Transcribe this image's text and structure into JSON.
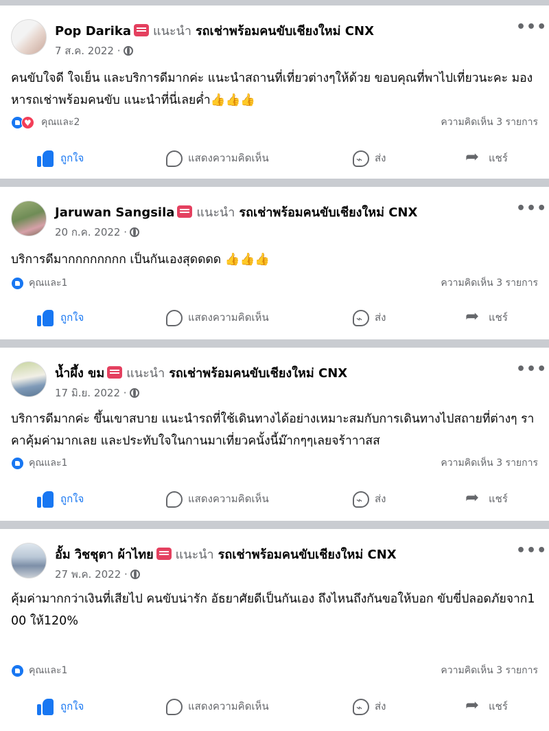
{
  "common": {
    "recommends": "แนะนำ",
    "page_name": "รถเช่าพร้อมคนขับเชียงใหม่ CNX",
    "more": "•••",
    "like_label": "ถูกใจ",
    "comment_label": "แสดงความคิดเห็น",
    "send_label": "ส่ง",
    "share_label": "แชร์",
    "comment_count": "ความคิดเห็น 3 รายการ"
  },
  "posts": [
    {
      "author": "Pop Darika",
      "date": "7 ส.ค. 2022 ·",
      "text": "คนขับใจดี ใจเย็น และบริการดีมากค่ะ แนะนำสถานที่เที่ยวต่างๆให้ด้วย ขอบคุณที่พาไปเที่ยวนะคะ มองหารถเช่าพร้อมคนขับ แนะนำที่นี่เลยค่ำ👍👍👍",
      "reactions_text": "คุณและ2",
      "reactions": [
        "like",
        "love"
      ]
    },
    {
      "author": "Jaruwan Sangsila",
      "date": "20 ก.ค. 2022 ·",
      "text": "บริการดีมากกกกกกกก เป็นกันเองสุดดดด 👍👍👍",
      "reactions_text": "คุณและ1",
      "reactions": [
        "like"
      ]
    },
    {
      "author": "น้ำผึ้ง ขม",
      "date": "17 มิ.ย. 2022 ·",
      "text": "บริการดีมากค่ะ ขึ้นเขาสบาย แนะนำรถที่ใช้เดินทางได้อย่างเหมาะสมกับการเดินทางไปสถายที่ต่างๆ ราคาคุ้มค่ามากเลย และประทับใจในกานมาเที่ยวคนั้งนี้ม๊ากๆๆเลยจร้าาาสส",
      "reactions_text": "คุณและ1",
      "reactions": [
        "like"
      ]
    },
    {
      "author": "อั้ม วิชชุตา ผ้าไทย",
      "date": "27 พ.ค. 2022 ·",
      "text": "คุ้มค่ามากกว่าเงินที่เสียไป คนขับน่ารัก อัธยาศัยดีเป็นกันเอง ถึงไหนถึงกันขอให้บอก ขับขี่ปลอดภัยจาก100 ให้120%",
      "reactions_text": "คุณและ1",
      "reactions": [
        "like"
      ]
    }
  ]
}
